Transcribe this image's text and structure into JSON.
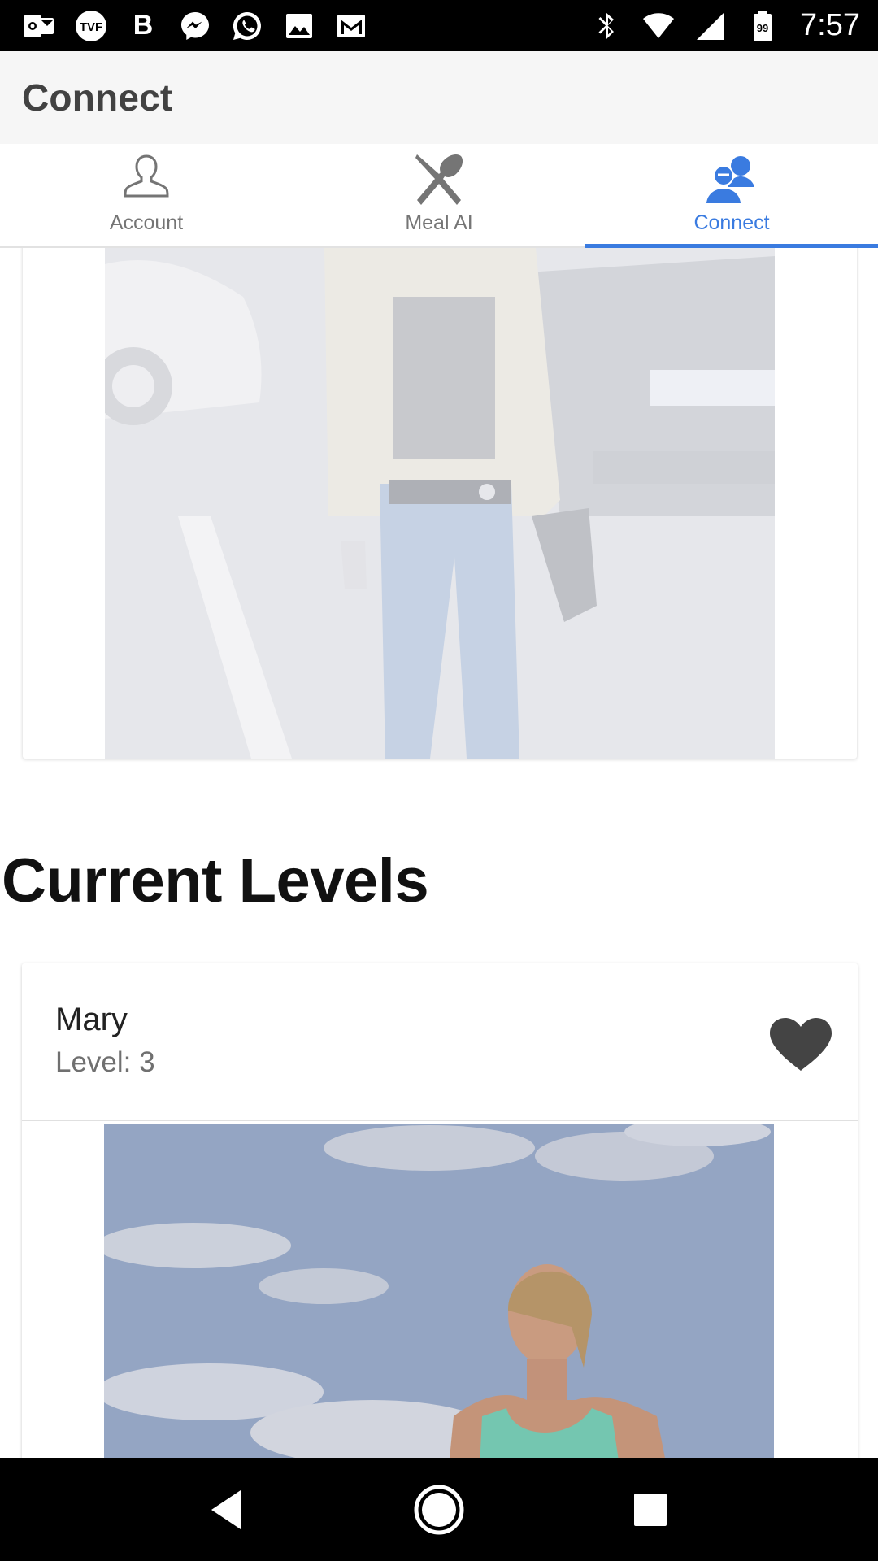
{
  "status_bar": {
    "time": "7:57",
    "notification_icons": [
      "outlook-icon",
      "tvf-icon",
      "b-icon",
      "messenger-icon",
      "whatsapp-icon",
      "gallery-icon",
      "gmail-icon"
    ],
    "tvf_label": "TVF",
    "b_label": "B",
    "battery_label": "99",
    "system_icons": [
      "bluetooth-icon",
      "wifi-icon",
      "cellular-icon",
      "battery-icon"
    ]
  },
  "app_bar": {
    "title": "Connect"
  },
  "tabs": [
    {
      "label": "Account",
      "icon": "account-icon",
      "active": false
    },
    {
      "label": "Meal AI",
      "icon": "utensils-icon",
      "active": false
    },
    {
      "label": "Connect",
      "icon": "people-icon",
      "active": true
    }
  ],
  "section": {
    "title": "Current Levels"
  },
  "user_card": {
    "name": "Mary",
    "level": "Level: 3",
    "like_icon": "heart-icon"
  },
  "colors": {
    "accent": "#3a7be0",
    "tab_inactive": "#757575",
    "app_bar_bg": "#f6f6f6",
    "heart": "#444444"
  },
  "nav_bar": {
    "buttons": [
      "back-icon",
      "home-icon",
      "recents-icon"
    ]
  }
}
